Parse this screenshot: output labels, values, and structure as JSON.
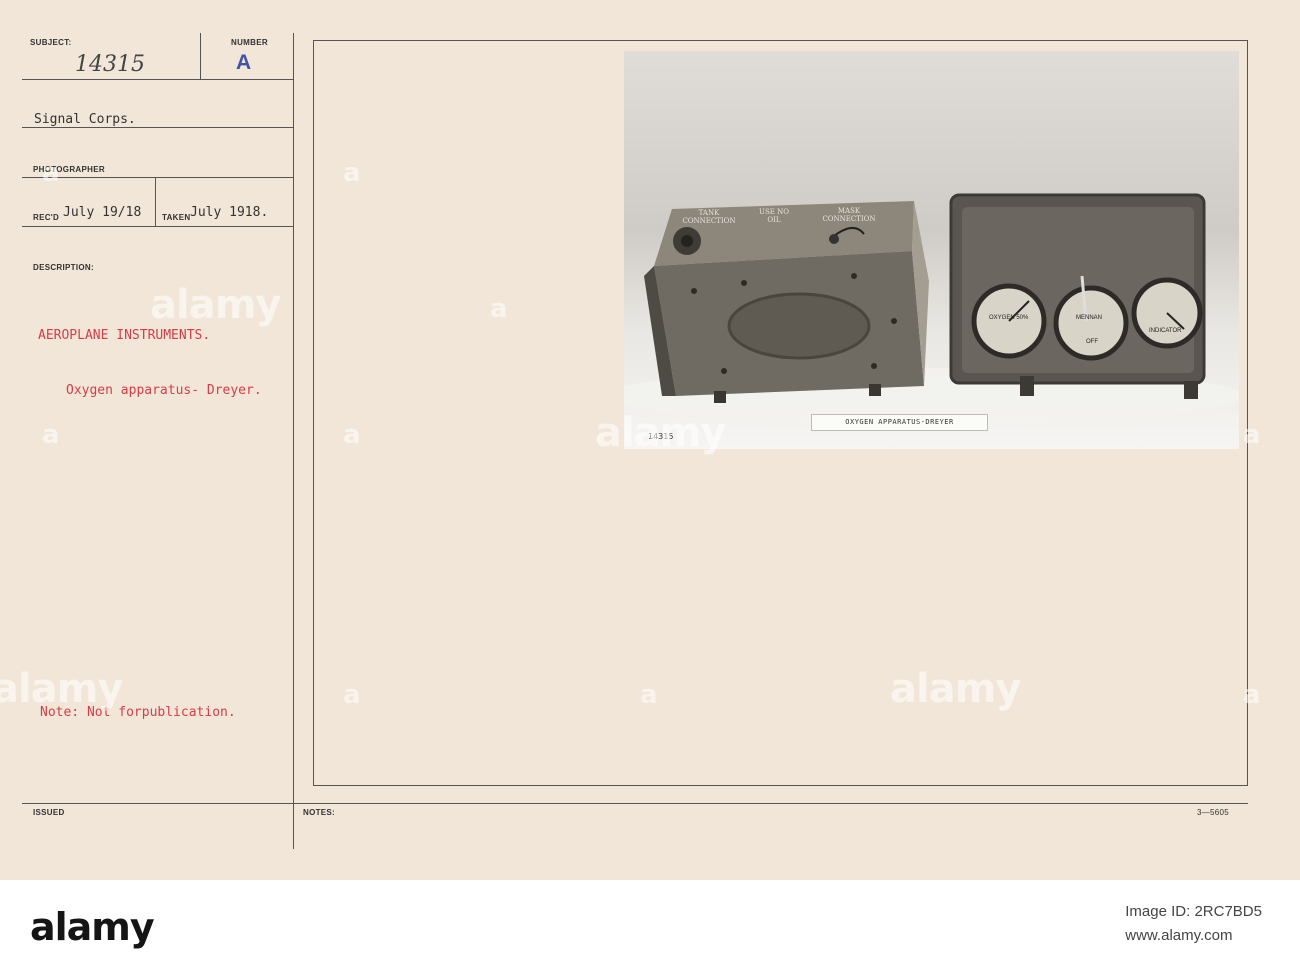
{
  "card": {
    "subject_label": "SUBJECT:",
    "subject_value": "14315",
    "number_label": "NUMBER",
    "number_value": "A",
    "source": "Signal Corps.",
    "photographer_label": "PHOTOGRAPHER",
    "recd_label": "REC'D",
    "recd_value": "July 19/18",
    "taken_label": "TAKEN",
    "taken_value": "July 1918.",
    "description_label": "DESCRIPTION:",
    "description_title": "AEROPLANE INSTRUMENTS.",
    "description_text": "Oxygen apparatus- Dreyer.",
    "note_prefix": "Note:",
    "note_text": "Not forpublication.",
    "issued_label": "ISSUED",
    "notes_label": "NOTES:",
    "form_number": "3—5605"
  },
  "photo": {
    "caption": "OXYGEN APPARATUS-DREYER",
    "plate_number": "14315",
    "box_label_tank": "TANK CONNECTION",
    "box_label_oil": "USE NO OIL",
    "box_label_mask": "MASK CONNECTION",
    "gauge_left": "OXYGEN 50%",
    "gauge_center": "MENNAN",
    "gauge_center_off": "OFF",
    "gauge_right": "INDICATOR"
  },
  "watermark": {
    "text": "alamy",
    "letter": "a"
  },
  "footer": {
    "logo": "alamy",
    "image_id_line": "Image ID: 2RC7BD5",
    "url_line": "www.alamy.com"
  },
  "colors": {
    "card": "#f1e6d8",
    "red_type": "#d93b47",
    "blue_stamp": "#3f53a8",
    "rule": "#555555"
  }
}
